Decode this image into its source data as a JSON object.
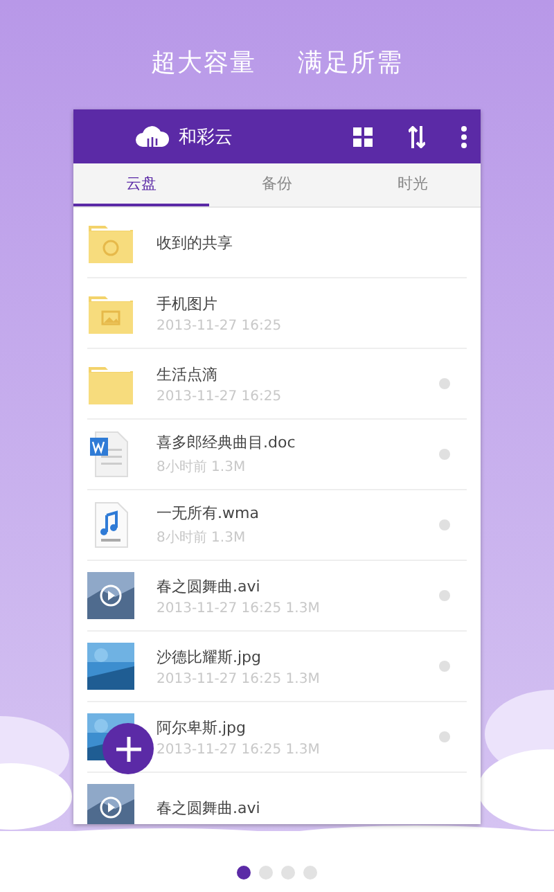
{
  "headline": [
    "超大容量",
    "满足所需"
  ],
  "app_bar": {
    "title": "和彩云"
  },
  "tabs": [
    {
      "label": "云盘",
      "selected": true
    },
    {
      "label": "备份",
      "selected": false
    },
    {
      "label": "时光",
      "selected": false
    }
  ],
  "files": [
    {
      "kind": "shared-folder",
      "name": "收到的共享",
      "menu_dot": false
    },
    {
      "kind": "image-folder",
      "name": "手机图片",
      "meta": "2013-11-27  16:25",
      "menu_dot": false
    },
    {
      "kind": "folder",
      "name": "生活点滴",
      "meta": "2013-11-27  16:25",
      "menu_dot": true
    },
    {
      "kind": "doc",
      "name": "喜多郎经典曲目.doc",
      "meta": "8小时前  1.3M",
      "menu_dot": true
    },
    {
      "kind": "audio",
      "name": "一无所有.wma",
      "meta": "8小时前  1.3M",
      "menu_dot": true
    },
    {
      "kind": "video",
      "name": "春之圆舞曲.avi",
      "meta": "2013-11-27  16:25  1.3M",
      "menu_dot": true
    },
    {
      "name": "沙德比耀斯.jpg",
      "meta": "2013-11-27  16:25  1.3M",
      "menu_dot": true
    },
    {
      "name": "阿尔卑斯.jpg",
      "meta": "2013-11-27  16:25  1.3M",
      "menu_dot": true
    },
    {
      "kind": "video",
      "name": "春之圆舞曲.avi",
      "menu_dot": false
    }
  ],
  "pager": [
    {
      "selected": true
    },
    {
      "selected": false
    },
    {
      "selected": false
    },
    {
      "selected": false
    }
  ]
}
